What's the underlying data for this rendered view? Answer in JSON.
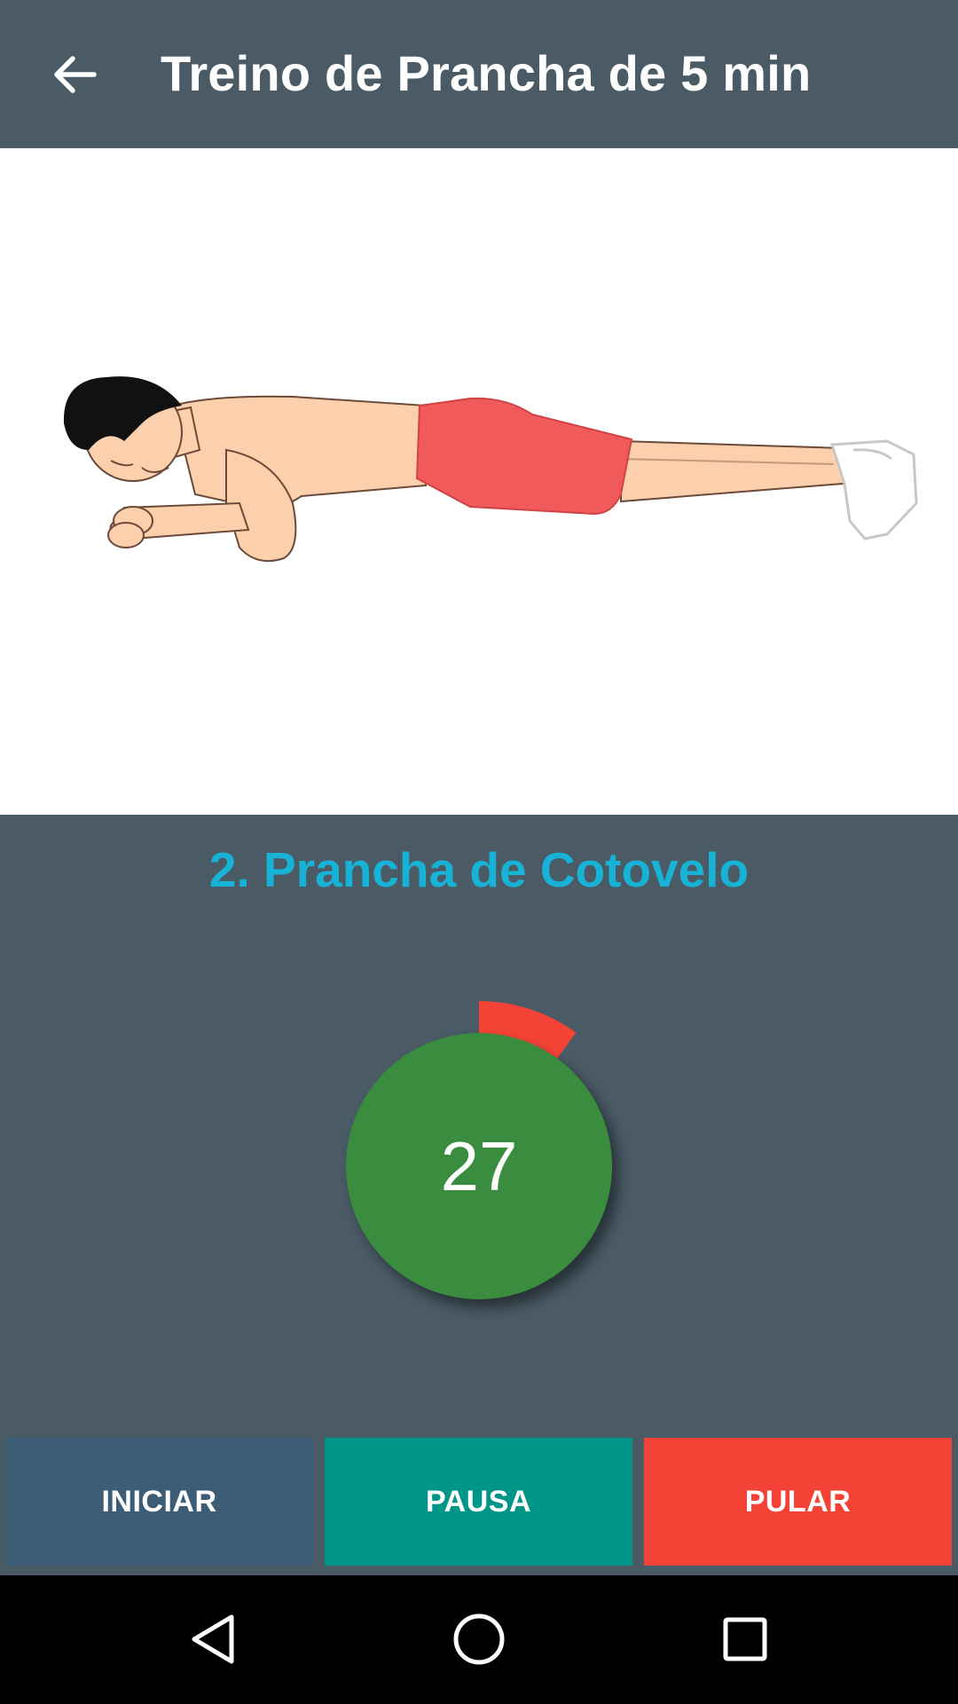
{
  "appbar": {
    "title": "Treino de Prancha de 5 min",
    "back_icon": "arrow-back-icon"
  },
  "exercise": {
    "title": "2. Prancha de Cotovelo",
    "illustration": "elbow-plank-figure"
  },
  "timer": {
    "value": "27",
    "progress_fraction": 0.1,
    "circle_color": "#3a8d3e",
    "progress_color": "#f44336"
  },
  "controls": {
    "start_label": "INICIAR",
    "pause_label": "PAUSA",
    "skip_label": "PULAR"
  },
  "colors": {
    "background": "#4a5b66",
    "accent_title": "#17b3d6",
    "start": "#3d5d77",
    "pause": "#009687",
    "skip": "#f44336"
  },
  "navbar": {
    "back_icon": "triangle-back-icon",
    "home_icon": "circle-home-icon",
    "recents_icon": "square-recents-icon"
  }
}
